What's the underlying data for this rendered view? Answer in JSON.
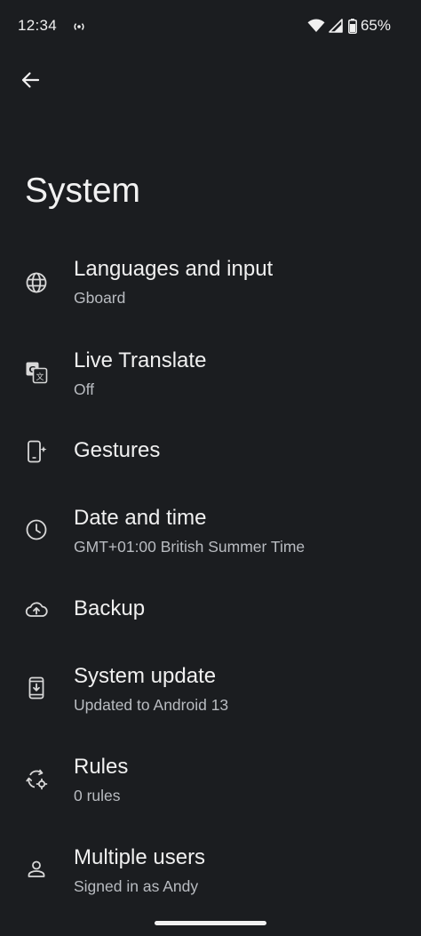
{
  "status_bar": {
    "time": "12:34",
    "hotspot_icon": "hotspot-icon",
    "wifi_icon": "wifi-icon",
    "signal_icon": "cellular-signal-icon",
    "battery_icon": "battery-icon",
    "battery_percent": "65%"
  },
  "header": {
    "back_icon": "arrow-back-icon",
    "title": "System"
  },
  "settings": [
    {
      "title": "Languages and input",
      "summary": "Gboard",
      "icon": "globe-icon"
    },
    {
      "title": "Live Translate",
      "summary": "Off",
      "icon": "translate-icon"
    },
    {
      "title": "Gestures",
      "summary": "",
      "icon": "gestures-phone-icon"
    },
    {
      "title": "Date and time",
      "summary": "GMT+01:00 British Summer Time",
      "icon": "clock-icon"
    },
    {
      "title": "Backup",
      "summary": "",
      "icon": "cloud-upload-icon"
    },
    {
      "title": "System update",
      "summary": "Updated to Android 13",
      "icon": "system-update-icon"
    },
    {
      "title": "Rules",
      "summary": "0 rules",
      "icon": "rules-icon"
    },
    {
      "title": "Multiple users",
      "summary": "Signed in as Andy",
      "icon": "person-icon"
    }
  ],
  "colors": {
    "background": "#1b1d20",
    "text_primary": "#f0f0f0",
    "text_secondary": "#b9bcc1"
  }
}
